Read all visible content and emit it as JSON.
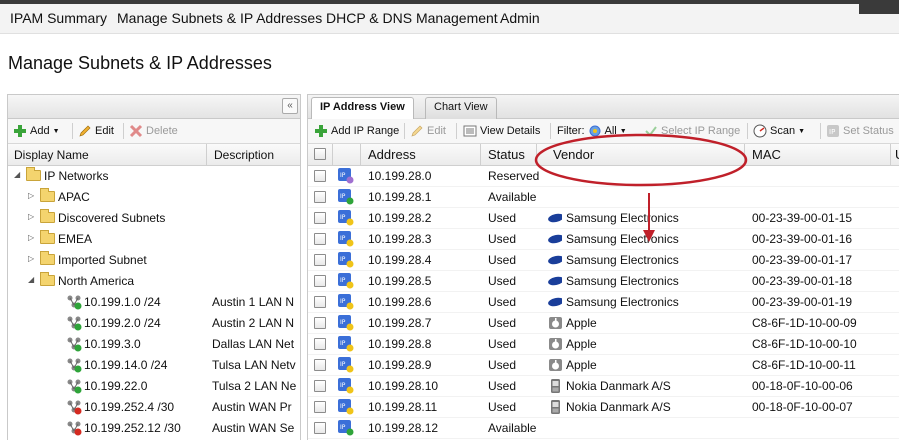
{
  "menu": [
    "IPAM Summary",
    "Manage Subnets & IP Addresses",
    "DHCP & DNS Management",
    "Admin"
  ],
  "page_title": "Manage Subnets & IP Addresses",
  "left_panel": {
    "collapse_label": "«",
    "toolbar": {
      "add": "Add",
      "edit": "Edit",
      "delete": "Delete"
    },
    "columns": [
      "Display Name",
      "Description"
    ],
    "tree": [
      {
        "label": "IP Networks",
        "type": "folder-open",
        "desc": ""
      },
      {
        "label": "APAC",
        "type": "folder",
        "desc": ""
      },
      {
        "label": "Discovered Subnets",
        "type": "folder",
        "desc": ""
      },
      {
        "label": "EMEA",
        "type": "folder",
        "desc": ""
      },
      {
        "label": "Imported Subnet",
        "type": "folder",
        "desc": ""
      },
      {
        "label": "North America",
        "type": "folder-open",
        "desc": ""
      },
      {
        "label": "10.199.1.0 /24",
        "type": "subnet",
        "status": "green",
        "desc": "Austin 1 LAN N"
      },
      {
        "label": "10.199.2.0 /24",
        "type": "subnet",
        "status": "green",
        "desc": "Austin 2 LAN N"
      },
      {
        "label": "10.199.3.0",
        "type": "subnet",
        "status": "green",
        "desc": "Dallas LAN Net"
      },
      {
        "label": "10.199.14.0 /24",
        "type": "subnet",
        "status": "green",
        "desc": "Tulsa LAN Netv"
      },
      {
        "label": "10.199.22.0",
        "type": "subnet",
        "status": "green",
        "desc": "Tulsa 2 LAN Ne"
      },
      {
        "label": "10.199.252.4 /30",
        "type": "subnet",
        "status": "red",
        "desc": "Austin WAN Pr"
      },
      {
        "label": "10.199.252.12 /30",
        "type": "subnet",
        "status": "red",
        "desc": "Austin WAN Se"
      }
    ]
  },
  "right_panel": {
    "tabs": [
      "IP Address View",
      "Chart View"
    ],
    "toolbar": {
      "add_ip_range": "Add IP Range",
      "edit": "Edit",
      "view_details": "View Details",
      "filter": "Filter:",
      "filter_value": "All",
      "select_ip_range": "Select IP Range",
      "scan": "Scan",
      "set_status": "Set Status"
    },
    "columns": [
      "Address",
      "Status",
      "Vendor",
      "MAC",
      "U"
    ],
    "rows": [
      {
        "address": "10.199.28.0",
        "status": "Reserved",
        "vendor": "",
        "vendor_icon": "",
        "mac": "",
        "state": "reserved"
      },
      {
        "address": "10.199.28.1",
        "status": "Available",
        "vendor": "",
        "vendor_icon": "",
        "mac": "",
        "state": "available"
      },
      {
        "address": "10.199.28.2",
        "status": "Used",
        "vendor": "Samsung Electronics",
        "vendor_icon": "samsung",
        "mac": "00-23-39-00-01-15",
        "state": "used"
      },
      {
        "address": "10.199.28.3",
        "status": "Used",
        "vendor": "Samsung Electronics",
        "vendor_icon": "samsung",
        "mac": "00-23-39-00-01-16",
        "state": "used"
      },
      {
        "address": "10.199.28.4",
        "status": "Used",
        "vendor": "Samsung Electronics",
        "vendor_icon": "samsung",
        "mac": "00-23-39-00-01-17",
        "state": "used"
      },
      {
        "address": "10.199.28.5",
        "status": "Used",
        "vendor": "Samsung Electronics",
        "vendor_icon": "samsung",
        "mac": "00-23-39-00-01-18",
        "state": "used"
      },
      {
        "address": "10.199.28.6",
        "status": "Used",
        "vendor": "Samsung Electronics",
        "vendor_icon": "samsung",
        "mac": "00-23-39-00-01-19",
        "state": "used"
      },
      {
        "address": "10.199.28.7",
        "status": "Used",
        "vendor": "Apple",
        "vendor_icon": "apple",
        "mac": "C8-6F-1D-10-00-09",
        "state": "used"
      },
      {
        "address": "10.199.28.8",
        "status": "Used",
        "vendor": "Apple",
        "vendor_icon": "apple",
        "mac": "C8-6F-1D-10-00-10",
        "state": "used"
      },
      {
        "address": "10.199.28.9",
        "status": "Used",
        "vendor": "Apple",
        "vendor_icon": "apple",
        "mac": "C8-6F-1D-10-00-11",
        "state": "used"
      },
      {
        "address": "10.199.28.10",
        "status": "Used",
        "vendor": "Nokia Danmark A/S",
        "vendor_icon": "nokia",
        "mac": "00-18-0F-10-00-06",
        "state": "used"
      },
      {
        "address": "10.199.28.11",
        "status": "Used",
        "vendor": "Nokia Danmark A/S",
        "vendor_icon": "nokia",
        "mac": "00-18-0F-10-00-07",
        "state": "used"
      },
      {
        "address": "10.199.28.12",
        "status": "Available",
        "vendor": "",
        "vendor_icon": "",
        "mac": "",
        "state": "available"
      }
    ]
  },
  "colors": {
    "annotation": "#c0202a",
    "status_green": "#2fa43a",
    "status_red": "#d42a20",
    "status_yellow": "#f0c419",
    "ip_icon_blue": "#3b6fd8"
  }
}
